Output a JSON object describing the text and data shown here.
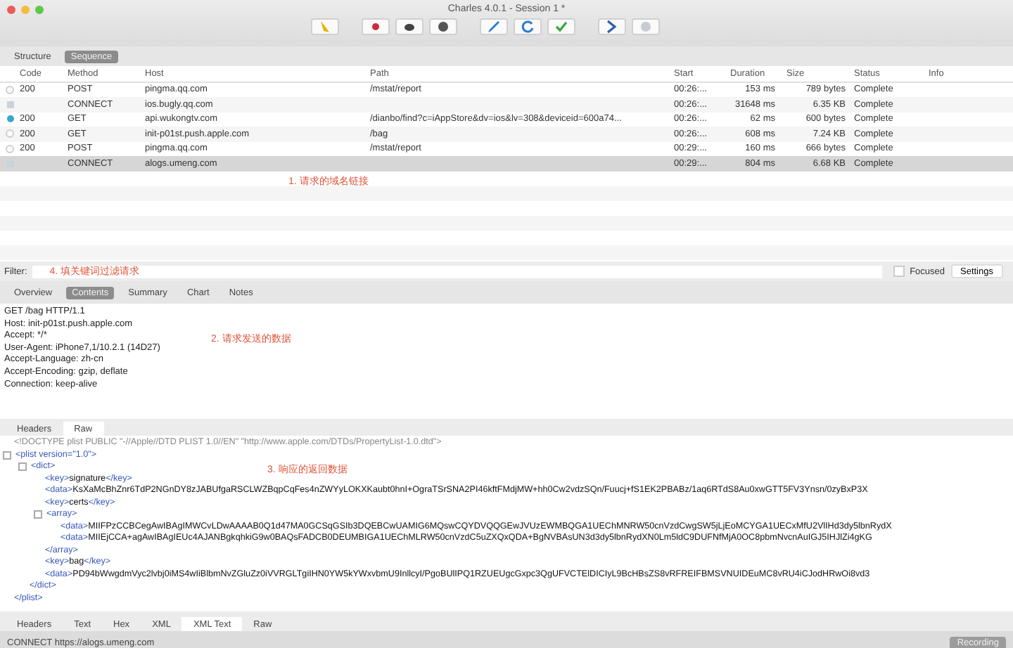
{
  "window": {
    "title": "Charles 4.0.1 - Session 1 *"
  },
  "view_tabs": [
    {
      "label": "Structure",
      "selected": false
    },
    {
      "label": "Sequence",
      "selected": true
    }
  ],
  "table": {
    "columns": [
      "Code",
      "Method",
      "Host",
      "Path",
      "Start",
      "Duration",
      "Size",
      "Status",
      "Info"
    ],
    "rows": [
      {
        "kind": "plain",
        "selected": false,
        "cells": [
          "200",
          "POST",
          "pingma.qq.com",
          "/mstat/report",
          "00:26:...",
          "153 ms",
          "789 bytes",
          "Complete",
          ""
        ]
      },
      {
        "kind": "tunnel",
        "selected": false,
        "cells": [
          "",
          "CONNECT",
          "ios.bugly.qq.com",
          "",
          "00:26:...",
          "31648 ms",
          "6.35 KB",
          "Complete",
          ""
        ]
      },
      {
        "kind": "active",
        "selected": false,
        "cells": [
          "200",
          "GET",
          "api.wukongtv.com",
          "/dianbo/find?c=iAppStore&dv=ios&lv=308&deviceid=600a74...",
          "00:26:...",
          "62 ms",
          "600 bytes",
          "Complete",
          ""
        ]
      },
      {
        "kind": "plain",
        "selected": false,
        "cells": [
          "200",
          "GET",
          "init-p01st.push.apple.com",
          "/bag",
          "00:26:...",
          "608 ms",
          "7.24 KB",
          "Complete",
          ""
        ]
      },
      {
        "kind": "plain",
        "selected": false,
        "cells": [
          "200",
          "POST",
          "pingma.qq.com",
          "/mstat/report",
          "00:29:...",
          "160 ms",
          "666 bytes",
          "Complete",
          ""
        ]
      },
      {
        "kind": "tunnel",
        "selected": true,
        "cells": [
          "",
          "CONNECT",
          "alogs.umeng.com",
          "",
          "00:29:...",
          "804 ms",
          "6.68 KB",
          "Complete",
          ""
        ]
      }
    ],
    "annotation": "1. 请求的域名链接"
  },
  "filter": {
    "label": "Filter:",
    "annotation": "4. 填关键词过滤请求",
    "focused": {
      "label": "Focused",
      "checked": false
    },
    "settings_button": "Settings"
  },
  "detail_tabs": [
    {
      "label": "Overview",
      "selected": false
    },
    {
      "label": "Contents",
      "selected": true
    },
    {
      "label": "Summary",
      "selected": false
    },
    {
      "label": "Chart",
      "selected": false
    },
    {
      "label": "Notes",
      "selected": false
    }
  ],
  "request": {
    "lines": [
      "GET /bag HTTP/1.1",
      "Host: init-p01st.push.apple.com",
      "Accept: */*",
      "User-Agent: iPhone7,1/10.2.1 (14D27)",
      "Accept-Language: zh-cn",
      "Accept-Encoding: gzip, deflate",
      "Connection: keep-alive"
    ],
    "annotation": "2. 请求发送的数据"
  },
  "request_tabs": [
    {
      "label": "Headers",
      "selected": false
    },
    {
      "label": "Raw",
      "selected": true
    }
  ],
  "response": {
    "doctype": "<!DOCTYPE plist PUBLIC \"-//Apple//DTD PLIST 1.0//EN\" \"http://www.apple.com/DTDs/PropertyList-1.0.dtd\">",
    "annotation": "3. 响应的返回数据",
    "tree": [
      {
        "open": "<plist version=\"1.0\">",
        "close": "</plist>",
        "children": [
          {
            "open": "<dict>",
            "close": "</dict>",
            "children": [
              {
                "open": "<key>",
                "text": "signature",
                "close": "</key>"
              },
              {
                "open": "<data>",
                "text": "KsXaMcBhZnr6TdP2NGnDY8zJABUfgaRSCLWZBqpCqFes4nZWYyLOKXKaubt0hnI+OgraTSrSNA2PI46kftFMdjMW+hh0Cw2vdzSQn/Fuucj+fS1EK2PBABz/1aq6RTdS8Au0xwGTT5FV3Ynsn/0zyBxP3X"
              },
              {
                "open": "<key>",
                "text": "certs",
                "close": "</key>"
              },
              {
                "open": "<array>",
                "close": "</array>",
                "children": [
                  {
                    "open": "<data>",
                    "text": "MIIFPzCCBCegAwIBAgIMWCvLDwAAAAB0Q1d47MA0GCSqGSIb3DQEBCwUAMIG6MQswCQYDVQQGEwJVUzEWMBQGA1UEChMNRW50cnVzdCwgSW5jLjEoMCYGA1UECxMfU2VlIHd3dy5lbnRydX"
                  },
                  {
                    "open": "<data>",
                    "text": "MIIEjCCA+agAwIBAgIEUc4AJANBgkqhkiG9w0BAQsFADCB0DEUMBIGA1UEChMLRW50cnVzdC5uZXQxQDA+BgNVBAsUN3d3dy5lbnRydXN0Lm5ldC9DUFNfMjA0OC8pbmNvcnAuIGJ5IHJlZi4gKG"
                  }
                ]
              },
              {
                "open": "<key>",
                "text": "bag",
                "close": "</key>"
              },
              {
                "open": "<data>",
                "text": "PD94bWwgdmVyc2lvbj0iMS4wIiBlbmNvZGluZz0iVVRGLTgiIHN0YW5kYWxvbmU9InllcyI/PgoBUlIPQ1RZUEUgcGxpc3QgUFVCTElDICIyL9BcHBsZS8vRFREIFBMSVNUIDEuMC8vRU4iCJodHRwOi8vd3"
              }
            ]
          }
        ]
      }
    ]
  },
  "response_tabs": [
    {
      "label": "Headers",
      "selected": false
    },
    {
      "label": "Text",
      "selected": false
    },
    {
      "label": "Hex",
      "selected": false
    },
    {
      "label": "XML",
      "selected": false
    },
    {
      "label": "XML Text",
      "selected": true
    },
    {
      "label": "Raw",
      "selected": false
    }
  ],
  "status_bar": {
    "text": "CONNECT https://alogs.umeng.com",
    "badge": "Recording"
  }
}
